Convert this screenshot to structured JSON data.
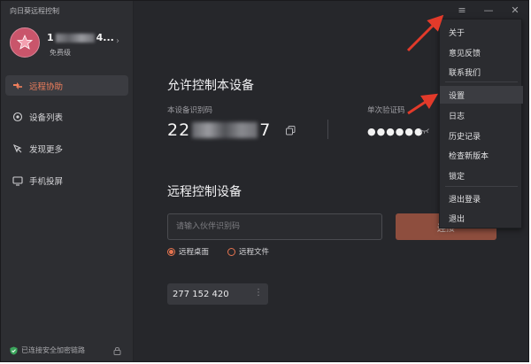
{
  "window": {
    "title": "向日葵远程控制",
    "controls": [
      "≡",
      "—",
      "✕"
    ]
  },
  "user": {
    "id_prefix": "1",
    "id_suffix": "4...",
    "level": "免费级"
  },
  "sidebar": {
    "items": [
      {
        "label": "远程协助",
        "icon": "remote-assist-icon",
        "active": true
      },
      {
        "label": "设备列表",
        "icon": "device-list-icon",
        "active": false
      },
      {
        "label": "发现更多",
        "icon": "discover-icon",
        "active": false
      },
      {
        "label": "手机投屏",
        "icon": "screen-cast-icon",
        "active": false
      }
    ],
    "status": "已连接安全加密链路"
  },
  "allow_control": {
    "title": "允许控制本设备",
    "code_label": "本设备识别码",
    "code_prefix": "22",
    "code_suffix": "7",
    "password_label": "单次验证码",
    "password": "●●●●●●"
  },
  "remote_control": {
    "title": "远程控制设备",
    "input_placeholder": "请输入伙伴识别码",
    "connect_label": "连接",
    "mode_desktop": "远程桌面",
    "mode_file": "远程文件",
    "history_code": "277 152 420"
  },
  "menu": {
    "items": [
      "关于",
      "意见反馈",
      "联系我们",
      "设置",
      "日志",
      "历史记录",
      "检查新版本",
      "锁定",
      "退出登录",
      "退出"
    ],
    "highlighted": "设置"
  },
  "colors": {
    "accent": "#e5744f",
    "annotation": "#e23a2a",
    "background": "#26272b",
    "sidebar": "#2d2e32"
  }
}
